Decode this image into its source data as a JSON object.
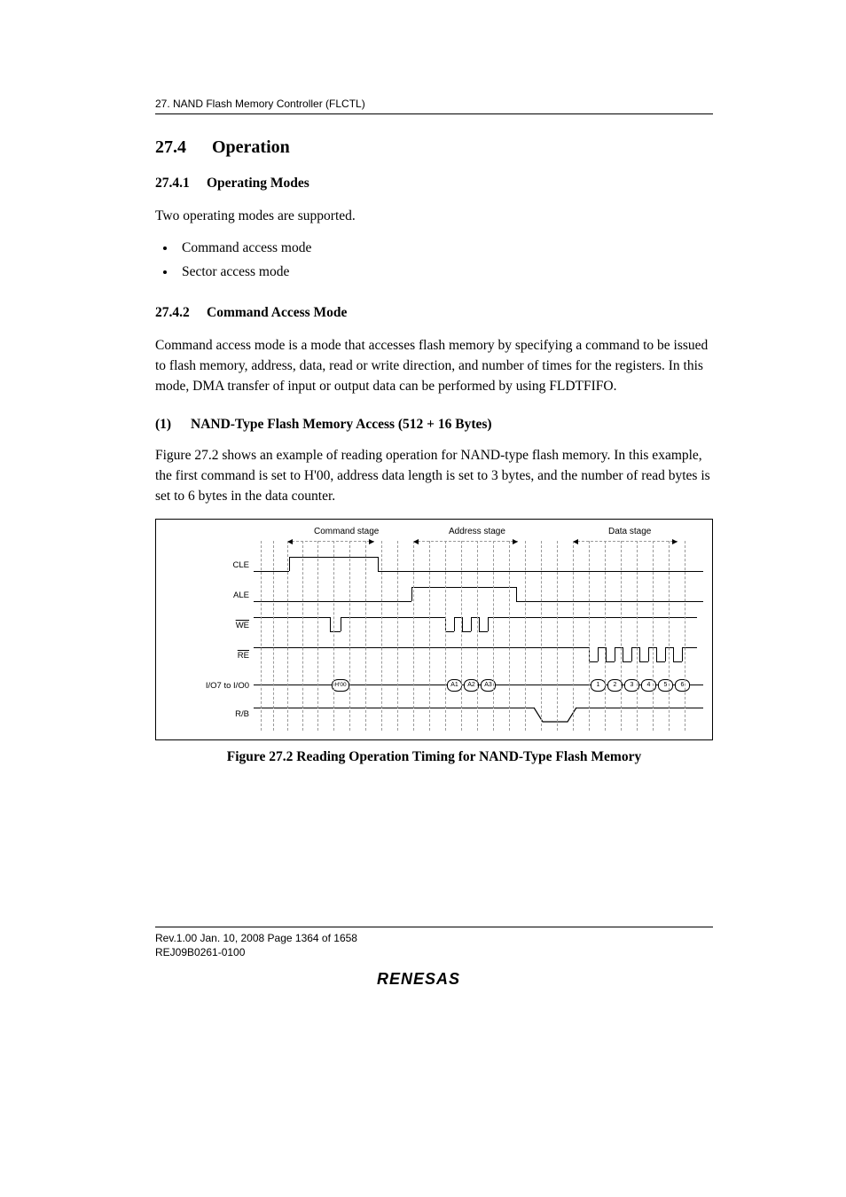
{
  "header": {
    "running": "27.   NAND Flash Memory Controller (FLCTL)"
  },
  "section": {
    "num": "27.4",
    "title": "Operation"
  },
  "sub1": {
    "num": "27.4.1",
    "title": "Operating Modes",
    "intro": "Two operating modes are supported.",
    "items": [
      "Command access mode",
      "Sector access mode"
    ]
  },
  "sub2": {
    "num": "27.4.2",
    "title": "Command Access Mode",
    "para": "Command access mode is a mode that accesses flash memory by specifying a command to be issued to flash memory, address, data, read or write direction, and number of times for the registers. In this mode, DMA transfer of input or output data can be performed by using FLDTFIFO."
  },
  "sub3": {
    "num": "(1)",
    "title": "NAND-Type Flash Memory Access (512 + 16 Bytes)",
    "para": "Figure 27.2 shows an example of reading operation for NAND-type flash memory. In this example, the first command is set to H'00, address data length is set to 3 bytes, and the number of read bytes is set to 6 bytes in the data counter."
  },
  "figure": {
    "stages": {
      "cmd": "Command stage",
      "addr": "Address stage",
      "data": "Data stage"
    },
    "signals": {
      "cle": "CLE",
      "ale": "ALE",
      "we": "WE",
      "re": "RE",
      "io": "I/O7 to I/O0",
      "rb": "R/B"
    },
    "bubbles": {
      "cmd": "H'00",
      "a1": "A1",
      "a2": "A2",
      "a3": "A3",
      "d1": "1",
      "d2": "2",
      "d3": "3",
      "d4": "4",
      "d5": "5",
      "d6": "6"
    },
    "caption": "Figure 27.2   Reading Operation Timing for NAND-Type Flash Memory"
  },
  "footer": {
    "line1": "Rev.1.00  Jan. 10, 2008  Page 1364 of 1658",
    "line2": "REJ09B0261-0100",
    "logo": "RENESAS"
  }
}
